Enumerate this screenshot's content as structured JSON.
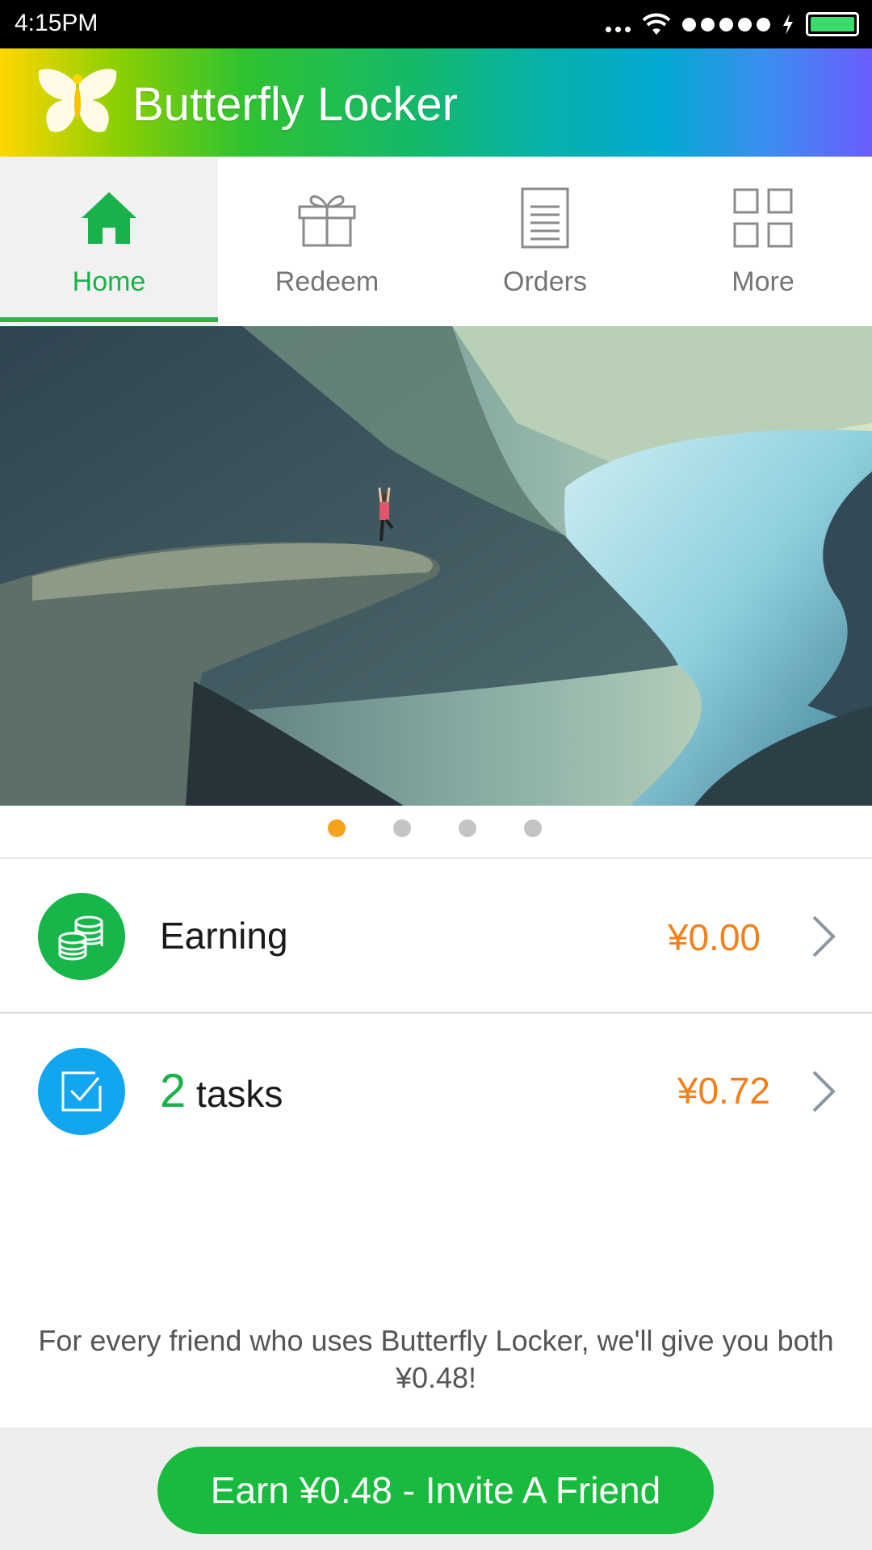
{
  "status_bar": {
    "time": "4:15PM",
    "battery_color": "#3ddc6a"
  },
  "app_bar": {
    "title": "Butterfly Locker",
    "logo_icon": "butterfly-icon"
  },
  "tabs": [
    {
      "label": "Home",
      "icon": "home-icon",
      "active": true
    },
    {
      "label": "Redeem",
      "icon": "gift-icon",
      "active": false
    },
    {
      "label": "Orders",
      "icon": "document-icon",
      "active": false
    },
    {
      "label": "More",
      "icon": "grid-icon",
      "active": false
    }
  ],
  "banner": {
    "pages": 4,
    "current_page": 1
  },
  "earning": {
    "label": "Earning",
    "amount": "¥0.00",
    "icon": "coins-icon",
    "icon_color": "#16b64a"
  },
  "tasks": {
    "count": "2",
    "label": "tasks",
    "amount": "¥0.72",
    "icon": "checkbox-icon",
    "icon_color": "#12a6ef"
  },
  "promo_text": "For every friend who uses Butterfly Locker, we'll give you both ¥0.48!",
  "invite_button": {
    "label": "Earn ¥0.48 - Invite A Friend",
    "color": "#19bb3e"
  },
  "colors": {
    "accent_green": "#18b14a",
    "amount_orange": "#f57f17",
    "pager_active": "#f7a21b"
  }
}
